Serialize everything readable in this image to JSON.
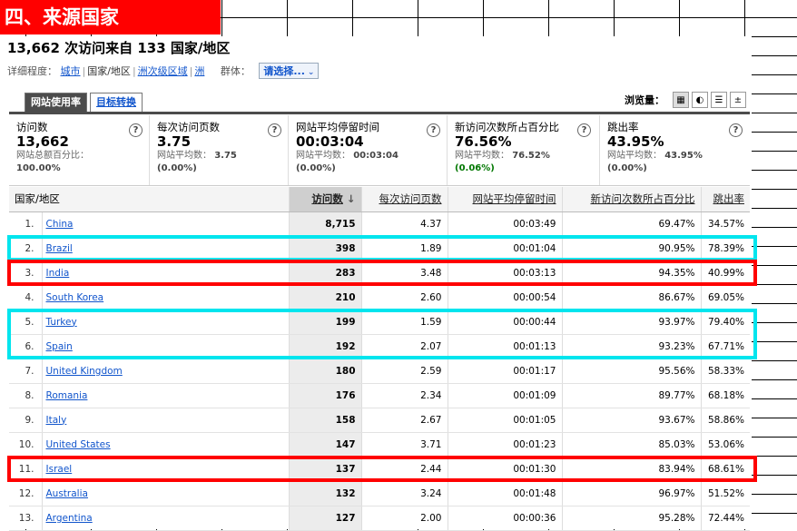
{
  "section_title": "四、来源国家",
  "summary": {
    "visits": "13,662",
    "text1": "次访问来自",
    "countries": "133",
    "text2": "国家/地区"
  },
  "detail": {
    "label": "详细程度：",
    "city": "城市",
    "country": "国家/地区",
    "subcontinent": "洲次级区域",
    "continent": "洲",
    "group_label": "群体：",
    "group_select": "请选择..."
  },
  "tabs": {
    "usage": "网站使用率",
    "goals": "目标转换"
  },
  "view_label": "浏览量：",
  "stats": [
    {
      "name": "访问数",
      "value": "13,662",
      "sub_label": "网站总额百分比：",
      "sub_value": "",
      "delta": "100.00%"
    },
    {
      "name": "每次访问页数",
      "value": "3.75",
      "sub_label": "网站平均数：",
      "sub_value": "3.75",
      "delta": "(0.00%)"
    },
    {
      "name": "网站平均停留时间",
      "value": "00:03:04",
      "sub_label": "网站平均数：",
      "sub_value": "00:03:04",
      "delta": "(0.00%)"
    },
    {
      "name": "新访问次数所占百分比",
      "value": "76.56%",
      "sub_label": "网站平均数：",
      "sub_value": "76.52%",
      "delta": "(0.06%)"
    },
    {
      "name": "跳出率",
      "value": "43.95%",
      "sub_label": "网站平均数：",
      "sub_value": "43.95%",
      "delta": "(0.00%)"
    }
  ],
  "table": {
    "headers": [
      "国家/地区",
      "访问数",
      "每次访问页数",
      "网站平均停留时间",
      "新访问次数所占百分比",
      "跳出率"
    ],
    "sort_arrow": "↓",
    "rows": [
      {
        "rank": "1.",
        "country": "China",
        "visits": "8,715",
        "pages": "4.37",
        "time": "00:03:49",
        "new": "69.47%",
        "bounce": "34.57%"
      },
      {
        "rank": "2.",
        "country": "Brazil",
        "visits": "398",
        "pages": "1.89",
        "time": "00:01:04",
        "new": "90.95%",
        "bounce": "78.39%"
      },
      {
        "rank": "3.",
        "country": "India",
        "visits": "283",
        "pages": "3.48",
        "time": "00:03:13",
        "new": "94.35%",
        "bounce": "40.99%"
      },
      {
        "rank": "4.",
        "country": "South Korea",
        "visits": "210",
        "pages": "2.60",
        "time": "00:00:54",
        "new": "86.67%",
        "bounce": "69.05%"
      },
      {
        "rank": "5.",
        "country": "Turkey",
        "visits": "199",
        "pages": "1.59",
        "time": "00:00:44",
        "new": "93.97%",
        "bounce": "79.40%"
      },
      {
        "rank": "6.",
        "country": "Spain",
        "visits": "192",
        "pages": "2.07",
        "time": "00:01:13",
        "new": "93.23%",
        "bounce": "67.71%"
      },
      {
        "rank": "7.",
        "country": "United Kingdom",
        "visits": "180",
        "pages": "2.59",
        "time": "00:01:17",
        "new": "95.56%",
        "bounce": "58.33%"
      },
      {
        "rank": "8.",
        "country": "Romania",
        "visits": "176",
        "pages": "2.34",
        "time": "00:01:09",
        "new": "89.77%",
        "bounce": "68.18%"
      },
      {
        "rank": "9.",
        "country": "Italy",
        "visits": "158",
        "pages": "2.67",
        "time": "00:01:05",
        "new": "93.67%",
        "bounce": "58.86%"
      },
      {
        "rank": "10.",
        "country": "United States",
        "visits": "147",
        "pages": "3.71",
        "time": "00:01:23",
        "new": "85.03%",
        "bounce": "53.06%"
      },
      {
        "rank": "11.",
        "country": "Israel",
        "visits": "137",
        "pages": "2.44",
        "time": "00:01:30",
        "new": "83.94%",
        "bounce": "68.61%"
      },
      {
        "rank": "12.",
        "country": "Australia",
        "visits": "132",
        "pages": "3.24",
        "time": "00:01:48",
        "new": "96.97%",
        "bounce": "51.52%"
      },
      {
        "rank": "13.",
        "country": "Argentina",
        "visits": "127",
        "pages": "2.00",
        "time": "00:00:36",
        "new": "95.28%",
        "bounce": "72.44%"
      }
    ]
  },
  "highlight_colors": {
    "red": "#ff0000",
    "cyan": "#00e5ee"
  },
  "highlights": [
    {
      "color": "cyan",
      "rows": [
        2
      ]
    },
    {
      "color": "red",
      "rows": [
        3
      ]
    },
    {
      "color": "cyan",
      "rows": [
        5,
        6
      ]
    },
    {
      "color": "red",
      "rows": [
        11
      ]
    }
  ]
}
